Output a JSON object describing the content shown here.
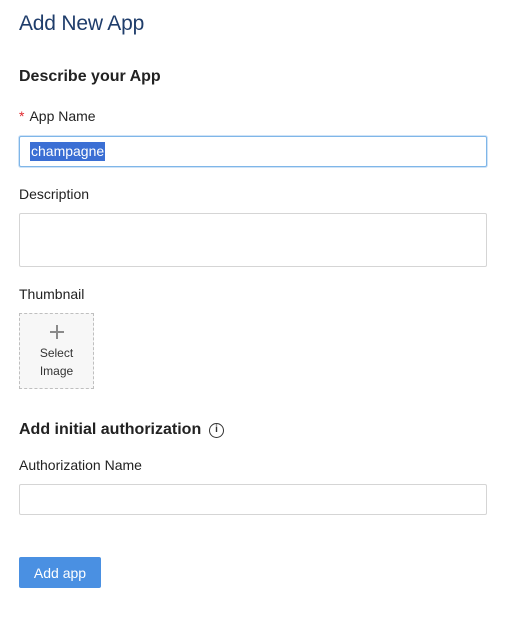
{
  "page": {
    "title": "Add New App"
  },
  "describe_section": {
    "title": "Describe your App",
    "app_name": {
      "required_marker": "*",
      "label": "App Name",
      "value": "champagne"
    },
    "description": {
      "label": "Description",
      "value": ""
    },
    "thumbnail": {
      "label": "Thumbnail",
      "select_line1": "Select",
      "select_line2": "Image",
      "icon": "plus-icon"
    }
  },
  "authorization_section": {
    "title": "Add initial authorization",
    "info_icon": "info-icon",
    "info_glyph": "i",
    "authorization_name": {
      "label": "Authorization Name",
      "value": ""
    }
  },
  "actions": {
    "add_app_label": "Add app"
  },
  "colors": {
    "title": "#1f3d6b",
    "primary_button": "#4a90e2",
    "required": "#e0282e",
    "focus_border": "#7fb6e8",
    "selection": "#3b6fd4"
  }
}
